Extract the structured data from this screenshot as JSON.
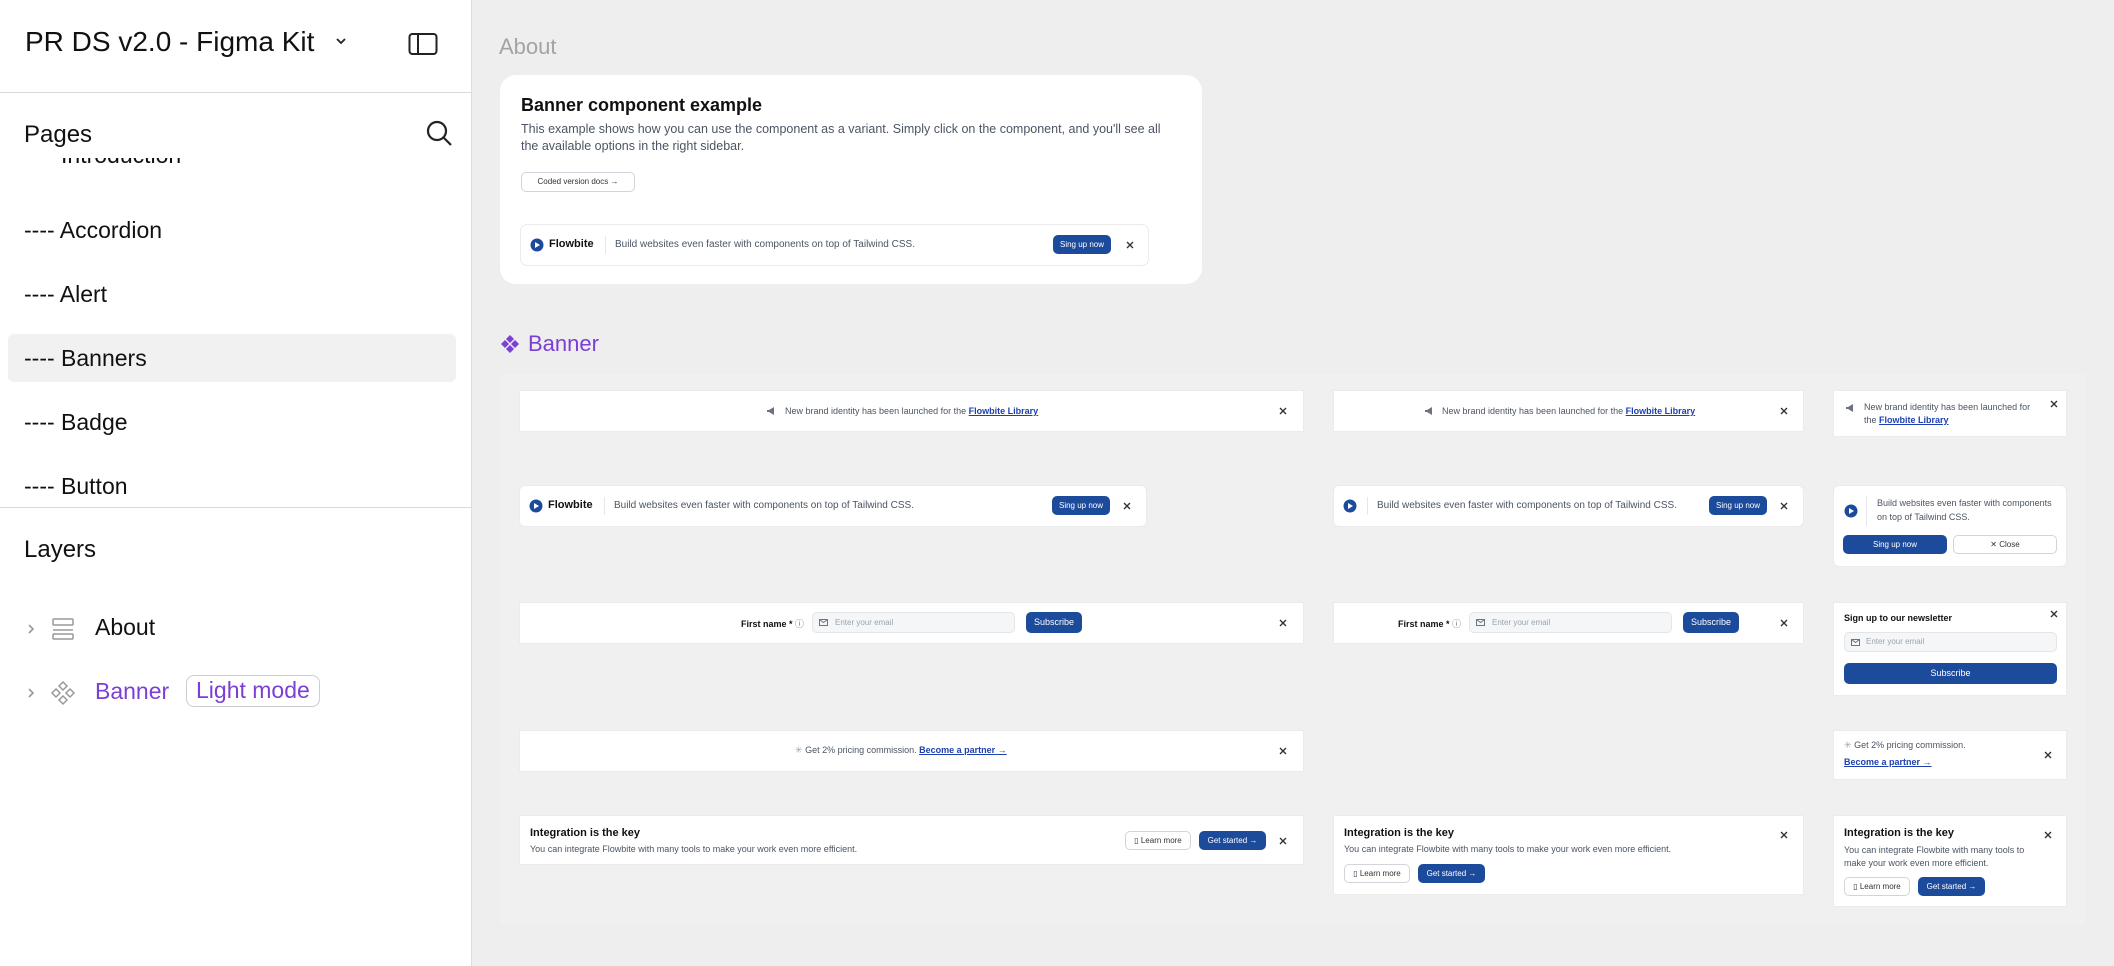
{
  "file": {
    "title": "PR DS v2.0 - Figma Kit"
  },
  "pages": {
    "label": "Pages",
    "partial_item": "---- Introduction",
    "items": [
      {
        "label": "---- Accordion"
      },
      {
        "label": "---- Alert"
      },
      {
        "label": "---- Banners"
      },
      {
        "label": "---- Badge"
      },
      {
        "label": "---- Button"
      }
    ],
    "selected": "---- Banners"
  },
  "layers": {
    "label": "Layers",
    "items": [
      {
        "name": "About",
        "icon": "frame-layout-icon"
      },
      {
        "name": "Banner",
        "icon": "component-icon",
        "badge": "Light mode"
      }
    ]
  },
  "canvas": {
    "about_frame_label": "About",
    "banner_frame_label": "Banner",
    "about_card": {
      "title": "Banner component example",
      "description": "This example shows how you can use the component as a variant. Simply click on the component, and you'll see all the available options in the right sidebar.",
      "docs_button": "Coded version docs →",
      "example_brand": "Flowbite",
      "example_text": "Build websites even faster with components on top of Tailwind CSS.",
      "example_cta": "Sing up now"
    },
    "banners": {
      "announce_text": "New brand identity has been launched for the",
      "announce_link": "Flowbite Library",
      "cta_brand": "Flowbite",
      "cta_text": "Build websites even faster with components on top of Tailwind CSS.",
      "cta_button": "Sing up now",
      "close_label": "Close",
      "first_name_label": "First name *",
      "email_placeholder": "Enter your email",
      "subscribe_label": "Subscribe",
      "newsletter_title": "Sign up to our newsletter",
      "pricing_text": "Get 2% pricing commission.",
      "partner_link": "Become a partner",
      "integration_title": "Integration is the key",
      "integration_text": "You can integrate Flowbite with many tools to make your work even more efficient.",
      "learn_more": "Learn more",
      "get_started": "Get started"
    }
  },
  "colors": {
    "accent_purple": "#7b3fd4",
    "primary_blue": "#1d4b9c"
  }
}
